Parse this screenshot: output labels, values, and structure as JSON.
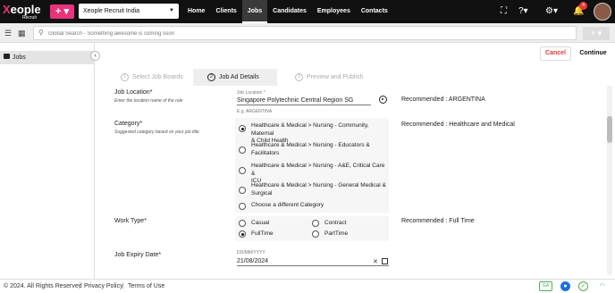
{
  "header": {
    "logo_main": "Xeople",
    "logo_sub": "Recruit",
    "company": "Xeople Recruit India",
    "nav": [
      "Home",
      "Clients",
      "Jobs",
      "Candidates",
      "Employees",
      "Contacts"
    ],
    "active_nav": "Jobs",
    "notification_count": "4"
  },
  "search": {
    "placeholder": "Global Search - Something awesome is coming soon"
  },
  "sidebar": {
    "items": [
      {
        "label": "Jobs",
        "icon": "briefcase-icon"
      }
    ]
  },
  "actions": {
    "cancel": "Cancel",
    "continue": "Continue"
  },
  "steps": [
    {
      "num": "1",
      "label": "Select Job Boards"
    },
    {
      "num": "2",
      "label": "Job Ad Details"
    },
    {
      "num": "3",
      "label": "Preview and Publish"
    }
  ],
  "form": {
    "location": {
      "label": "Job Location*",
      "hint": "Enter the location name of the role",
      "field_label": "Job Location *",
      "value": "Singapore Polytechnic Central Region SG",
      "example": "E.g. ARGENTINA",
      "recommended": "Recommended : ARGENTINA"
    },
    "category": {
      "label": "Category*",
      "hint": "Suggested category based on your job title",
      "recommended": "Recommended : Healthcare and Medical",
      "options": [
        {
          "line1": "Healthcare & Medical > Nursing - Community, Maternal",
          "line2": "& Child Health",
          "checked": true
        },
        {
          "line1": "Healthcare & Medical > Nursing - Educators &",
          "line2": "Facilitators",
          "checked": false
        },
        {
          "line1": "Healthcare & Medical > Nursing - A&E, Critical Care &",
          "line2": "ICU",
          "checked": false
        },
        {
          "line1": "Healthcare & Medical > Nursing - General Medical &",
          "line2": "Surgical",
          "checked": false
        },
        {
          "line1": "Choose a different Category",
          "line2": "",
          "checked": false
        }
      ]
    },
    "work_type": {
      "label": "Work Type*",
      "recommended": "Recommended : Full Time",
      "options": [
        {
          "label": "Casual",
          "checked": false
        },
        {
          "label": "Contract",
          "checked": false
        },
        {
          "label": "FullTime",
          "checked": true
        },
        {
          "label": "PartTime",
          "checked": false
        }
      ]
    },
    "expiry": {
      "label": "Job Expiry Date*",
      "format": "DD/MM/YYYY",
      "value": "21/08/2024"
    }
  },
  "footer": {
    "copyright": "© 2024. All Rights Reserved",
    "privacy": "Privacy Policy",
    "terms": "Terms of Use",
    "ga": "GA"
  }
}
